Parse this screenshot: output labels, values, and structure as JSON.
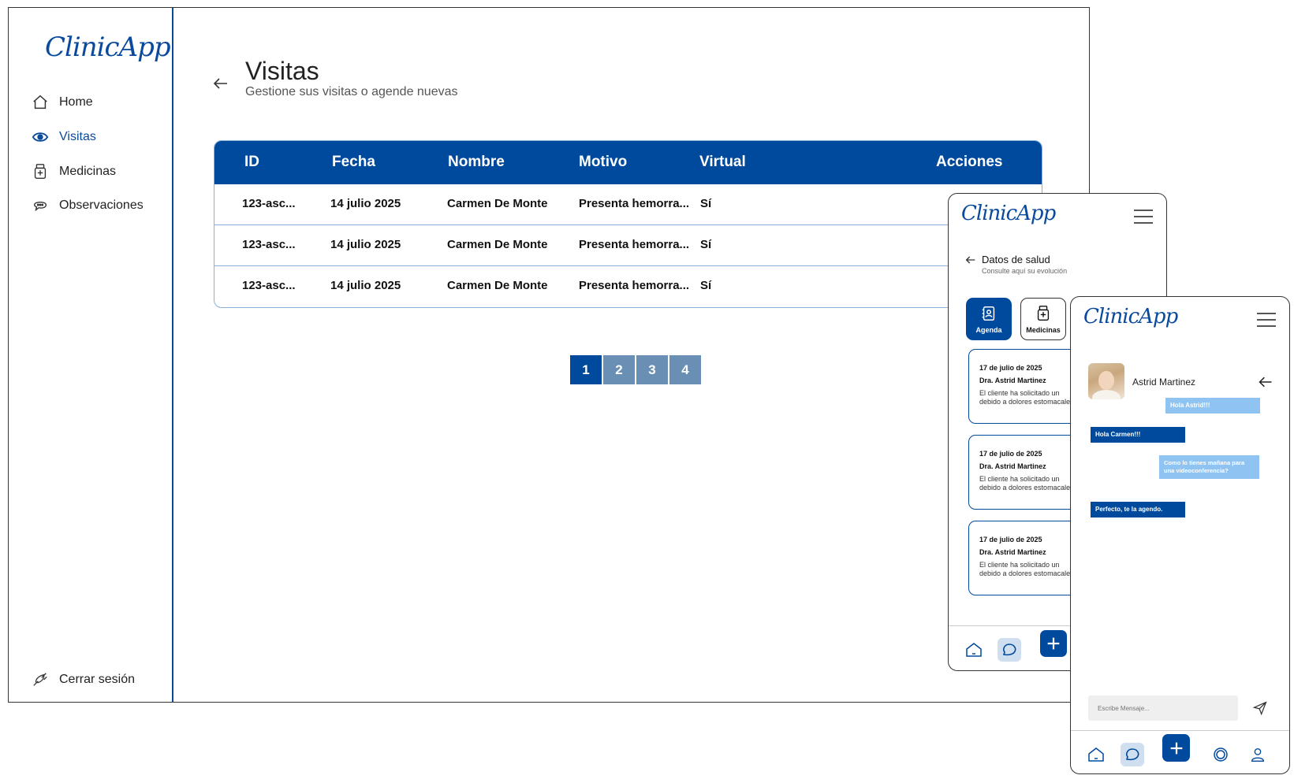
{
  "colors": {
    "primary": "#004a9e",
    "light_blue": "#8ec3f2",
    "pager_inactive": "#6a8fb4",
    "border_blue": "#8ab0d8"
  },
  "desktop": {
    "logo": "ClinicApp",
    "nav": [
      {
        "label": "Home",
        "icon": "home-icon"
      },
      {
        "label": "Visitas",
        "icon": "eye-icon",
        "active": true
      },
      {
        "label": "Medicinas",
        "icon": "medicine-kit-icon"
      },
      {
        "label": "Observaciones",
        "icon": "chat-bubbles-icon"
      }
    ],
    "logout_label": "Cerrar sesión",
    "page": {
      "title": "Visitas",
      "subtitle": "Gestione sus visitas o agende nuevas"
    },
    "table": {
      "headers": [
        "ID",
        "Fecha",
        "Nombre",
        "Motivo",
        "Virtual",
        "Acciones"
      ],
      "rows": [
        [
          "123-asc...",
          "14 julio 2025",
          "Carmen De Monte",
          "Presenta hemorra...",
          "Sí"
        ],
        [
          "123-asc...",
          "14 julio 2025",
          "Carmen De Monte",
          "Presenta hemorra...",
          "Sí"
        ],
        [
          "123-asc...",
          "14 julio 2025",
          "Carmen De Monte",
          "Presenta hemorra...",
          "Sí"
        ]
      ]
    },
    "pagination": {
      "pages": [
        "1",
        "2",
        "3",
        "4"
      ],
      "current": "1"
    }
  },
  "phone_health": {
    "logo": "ClinicApp",
    "title": "Datos de salud",
    "subtitle": "Consulte aquí su evolución",
    "tabs": [
      {
        "label": "Agenda",
        "icon": "agenda-icon",
        "active": true
      },
      {
        "label": "Medicinas",
        "icon": "medicine-kit-icon",
        "active": false
      }
    ],
    "cards": [
      {
        "date": "17 de julio de 2025",
        "doctor": "Dra. Astrid Martinez",
        "line1": "El cliente ha solicitado un",
        "line2": "debido a dolores estomacales"
      },
      {
        "date": "17 de julio de 2025",
        "doctor": "Dra. Astrid Martinez",
        "line1": "El cliente ha solicitado un",
        "line2": "debido a dolores estomacales"
      },
      {
        "date": "17 de julio de 2025",
        "doctor": "Dra. Astrid Martinez",
        "line1": "El cliente ha solicitado un",
        "line2": "debido a dolores estomacales"
      }
    ]
  },
  "phone_chat": {
    "logo": "ClinicApp",
    "contact_name": "Astrid Martinez",
    "messages": [
      {
        "text": "Hola Astrid!!!",
        "side": "out"
      },
      {
        "text": "Hola Carmen!!!",
        "side": "in"
      },
      {
        "text": "Como lo tienes mañana para una videoconferencia?",
        "side": "out"
      },
      {
        "text": "Perfecto, te la agendo.",
        "side": "in"
      }
    ],
    "input_placeholder": "Escribe Mensaje...",
    "bottom_nav": [
      "home-icon",
      "chat-icon",
      "plus-icon",
      "camera-icon",
      "user-icon"
    ]
  }
}
